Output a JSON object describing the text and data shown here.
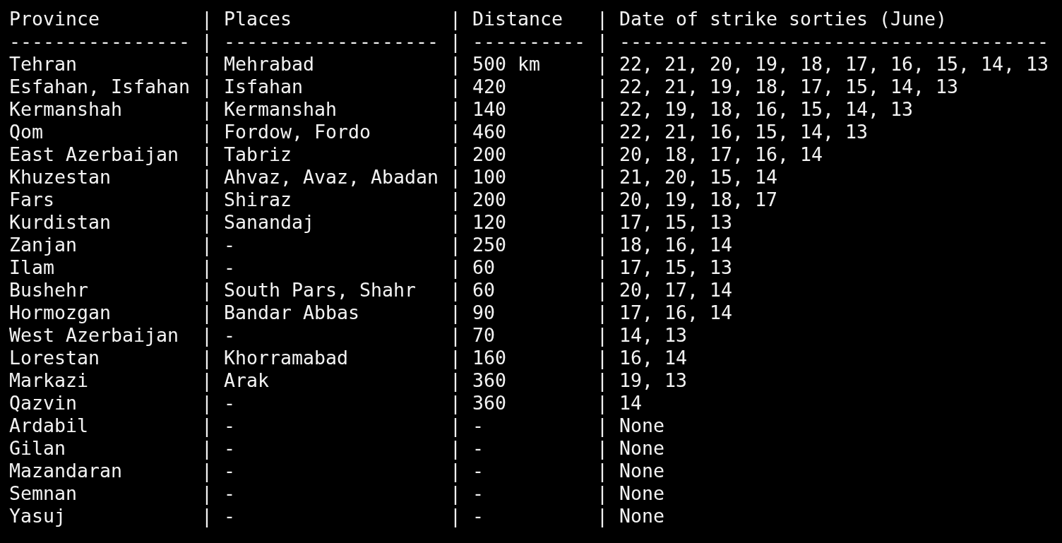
{
  "header": [
    "Province",
    "|",
    "Places",
    "|",
    "Distance",
    "|",
    "Date of strike sorties (June)"
  ],
  "rule": [
    "----------------",
    "|",
    "-------------------",
    "|",
    "----------",
    "|",
    "--------------------------------------"
  ],
  "rows": [
    [
      "Tehran",
      "|",
      "Mehrabad",
      "|",
      "500 km",
      "|",
      "22, 21, 20, 19, 18, 17, 16, 15, 14, 13"
    ],
    [
      "Esfahan, Isfahan",
      "|",
      "Isfahan",
      "|",
      "420",
      "|",
      "22, 21, 19, 18, 17, 15, 14, 13"
    ],
    [
      "Kermanshah",
      "|",
      "Kermanshah",
      "|",
      "140",
      "|",
      "22, 19, 18, 16, 15, 14, 13"
    ],
    [
      "Qom",
      "|",
      "Fordow, Fordo",
      "|",
      "460",
      "|",
      "22, 21, 16, 15, 14, 13"
    ],
    [
      "East Azerbaijan",
      "|",
      "Tabriz",
      "|",
      "200",
      "|",
      "20, 18, 17, 16, 14"
    ],
    [
      "Khuzestan",
      "|",
      "Ahvaz, Avaz, Abadan",
      "|",
      "100",
      "|",
      "21, 20, 15, 14"
    ],
    [
      "Fars",
      "|",
      "Shiraz",
      "|",
      "200",
      "|",
      "20, 19, 18, 17"
    ],
    [
      "Kurdistan",
      "|",
      "Sanandaj",
      "|",
      "120",
      "|",
      "17, 15, 13"
    ],
    [
      "Zanjan",
      "|",
      "-",
      "|",
      "250",
      "|",
      "18, 16, 14"
    ],
    [
      "Ilam",
      "|",
      "-",
      "|",
      "60",
      "|",
      "17, 15, 13"
    ],
    [
      "Bushehr",
      "|",
      "South Pars, Shahr",
      "|",
      "60",
      "|",
      "20, 17, 14"
    ],
    [
      "Hormozgan",
      "|",
      "Bandar Abbas",
      "|",
      "90",
      "|",
      "17, 16, 14"
    ],
    [
      "West Azerbaijan",
      "|",
      "-",
      "|",
      "70",
      "|",
      "14, 13"
    ],
    [
      "Lorestan",
      "|",
      "Khorramabad",
      "|",
      "160",
      "|",
      "16, 14"
    ],
    [
      "Markazi",
      "|",
      "Arak",
      "|",
      "360",
      "|",
      "19, 13"
    ],
    [
      "Qazvin",
      "|",
      "-",
      "|",
      "360",
      "|",
      "14"
    ],
    [
      "Ardabil",
      "|",
      "-",
      "|",
      "-",
      "|",
      "None"
    ],
    [
      "Gilan",
      "|",
      "-",
      "|",
      "-",
      "|",
      "None"
    ],
    [
      "Mazandaran",
      "|",
      "-",
      "|",
      "-",
      "|",
      "None"
    ],
    [
      "Semnan",
      "|",
      "-",
      "|",
      "-",
      "|",
      "None"
    ],
    [
      "Yasuj",
      "|",
      "-",
      "|",
      "-",
      "|",
      "None"
    ]
  ]
}
